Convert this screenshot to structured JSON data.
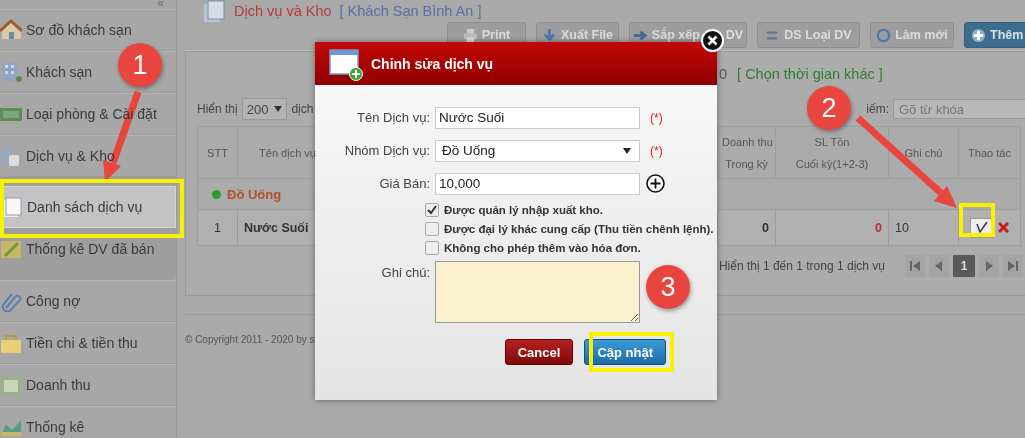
{
  "sidebar": {
    "collapse": "«",
    "items": [
      {
        "label": "Sơ đồ khách sạn",
        "selected": false,
        "kind": "item"
      },
      {
        "label": "Khách sạn",
        "selected": false,
        "kind": "item"
      },
      {
        "label": "Loại phòng & Cài đặt",
        "selected": false,
        "kind": "item"
      },
      {
        "label": "Dịch vụ & Kho",
        "selected": false,
        "kind": "item"
      },
      {
        "label": "Danh sách dịch vụ",
        "selected": true,
        "kind": "subitem"
      },
      {
        "label": "Thống kê DV đã bán",
        "selected": false,
        "kind": "subitem"
      },
      {
        "label": "Công nợ",
        "selected": false,
        "kind": "item"
      },
      {
        "label": "Tiền chi & tiền thu",
        "selected": false,
        "kind": "item"
      },
      {
        "label": "Doanh thu",
        "selected": false,
        "kind": "item"
      },
      {
        "label": "Thống kê",
        "selected": false,
        "kind": "item"
      }
    ]
  },
  "header": {
    "title": "Dịch vụ và Kho",
    "hotel": "[ Khách Sạn Bình An ]"
  },
  "toolbar": [
    {
      "label": "Print",
      "kind": "print"
    },
    {
      "label": "Xuất File",
      "kind": "export"
    },
    {
      "label": "Sắp xếp",
      "suffix": "DV",
      "kind": "sort"
    },
    {
      "label": "DS Loại DV",
      "kind": "list"
    },
    {
      "label": "Làm mới",
      "kind": "refresh"
    },
    {
      "label": "Thêm",
      "kind": "add"
    }
  ],
  "date_bar": {
    "date_end": "0",
    "link": "[ Chọn thời gian khác ]"
  },
  "table_controls": {
    "show_label": "Hiển thị",
    "page_size": "200",
    "show_suffix": "dịch",
    "search_label": "iếm:",
    "search_placeholder": "Gõ từ khóa"
  },
  "table": {
    "columns": [
      {
        "lines": [
          "STT"
        ]
      },
      {
        "lines": [
          "Tên dịch vụ"
        ]
      },
      {
        "lines": [
          "Doanh thu",
          "Trong kỳ"
        ]
      },
      {
        "lines": [
          "SL Tồn",
          "Cuối kỳ(1+2-3)"
        ]
      },
      {
        "lines": [
          "Ghi chú"
        ]
      },
      {
        "lines": [
          "Thao tác"
        ]
      }
    ],
    "groups": [
      {
        "name": "Đồ Uống",
        "color": "#2e9a2e",
        "rows": [
          {
            "stt": "1",
            "name": "Nước Suối",
            "revenue": "0",
            "stock": "0",
            "stock_alert": true,
            "note": "10"
          }
        ]
      }
    ]
  },
  "pagination": {
    "summary": "Hiển thị 1 đến 1 trong 1 dịch vụ",
    "pages": [
      {
        "label": "1",
        "selected": true
      }
    ]
  },
  "footer": "© Copyright 2011 - 2020 by s",
  "dialog": {
    "title": "Chỉnh sửa dịch vụ",
    "fields": [
      {
        "kind": "text",
        "label": "Tên Dịch vụ:",
        "value": "Nước Suối",
        "required_mark": "(*)"
      },
      {
        "kind": "select",
        "label": "Nhóm Dịch vụ:",
        "value": "Đồ Uống",
        "required_mark": "(*)"
      },
      {
        "kind": "text_add",
        "label": "Giá Bán:",
        "value": "10,000"
      }
    ],
    "options": [
      {
        "label": "Được quản lý nhập xuất kho.",
        "checked": true
      },
      {
        "label": "Được đại lý khác cung cấp (Thu tiền chênh lệnh).",
        "checked": false
      },
      {
        "label": "Không cho phép thêm vào hóa đơn.",
        "checked": false
      }
    ],
    "note_label": "Ghi chú:",
    "buttons": [
      {
        "label": "Cancel",
        "kind": "cancel"
      },
      {
        "label": "Cập nhật",
        "kind": "primary"
      }
    ]
  },
  "annotations": {
    "badges": [
      {
        "number": "1"
      },
      {
        "number": "2"
      },
      {
        "number": "3"
      }
    ]
  }
}
